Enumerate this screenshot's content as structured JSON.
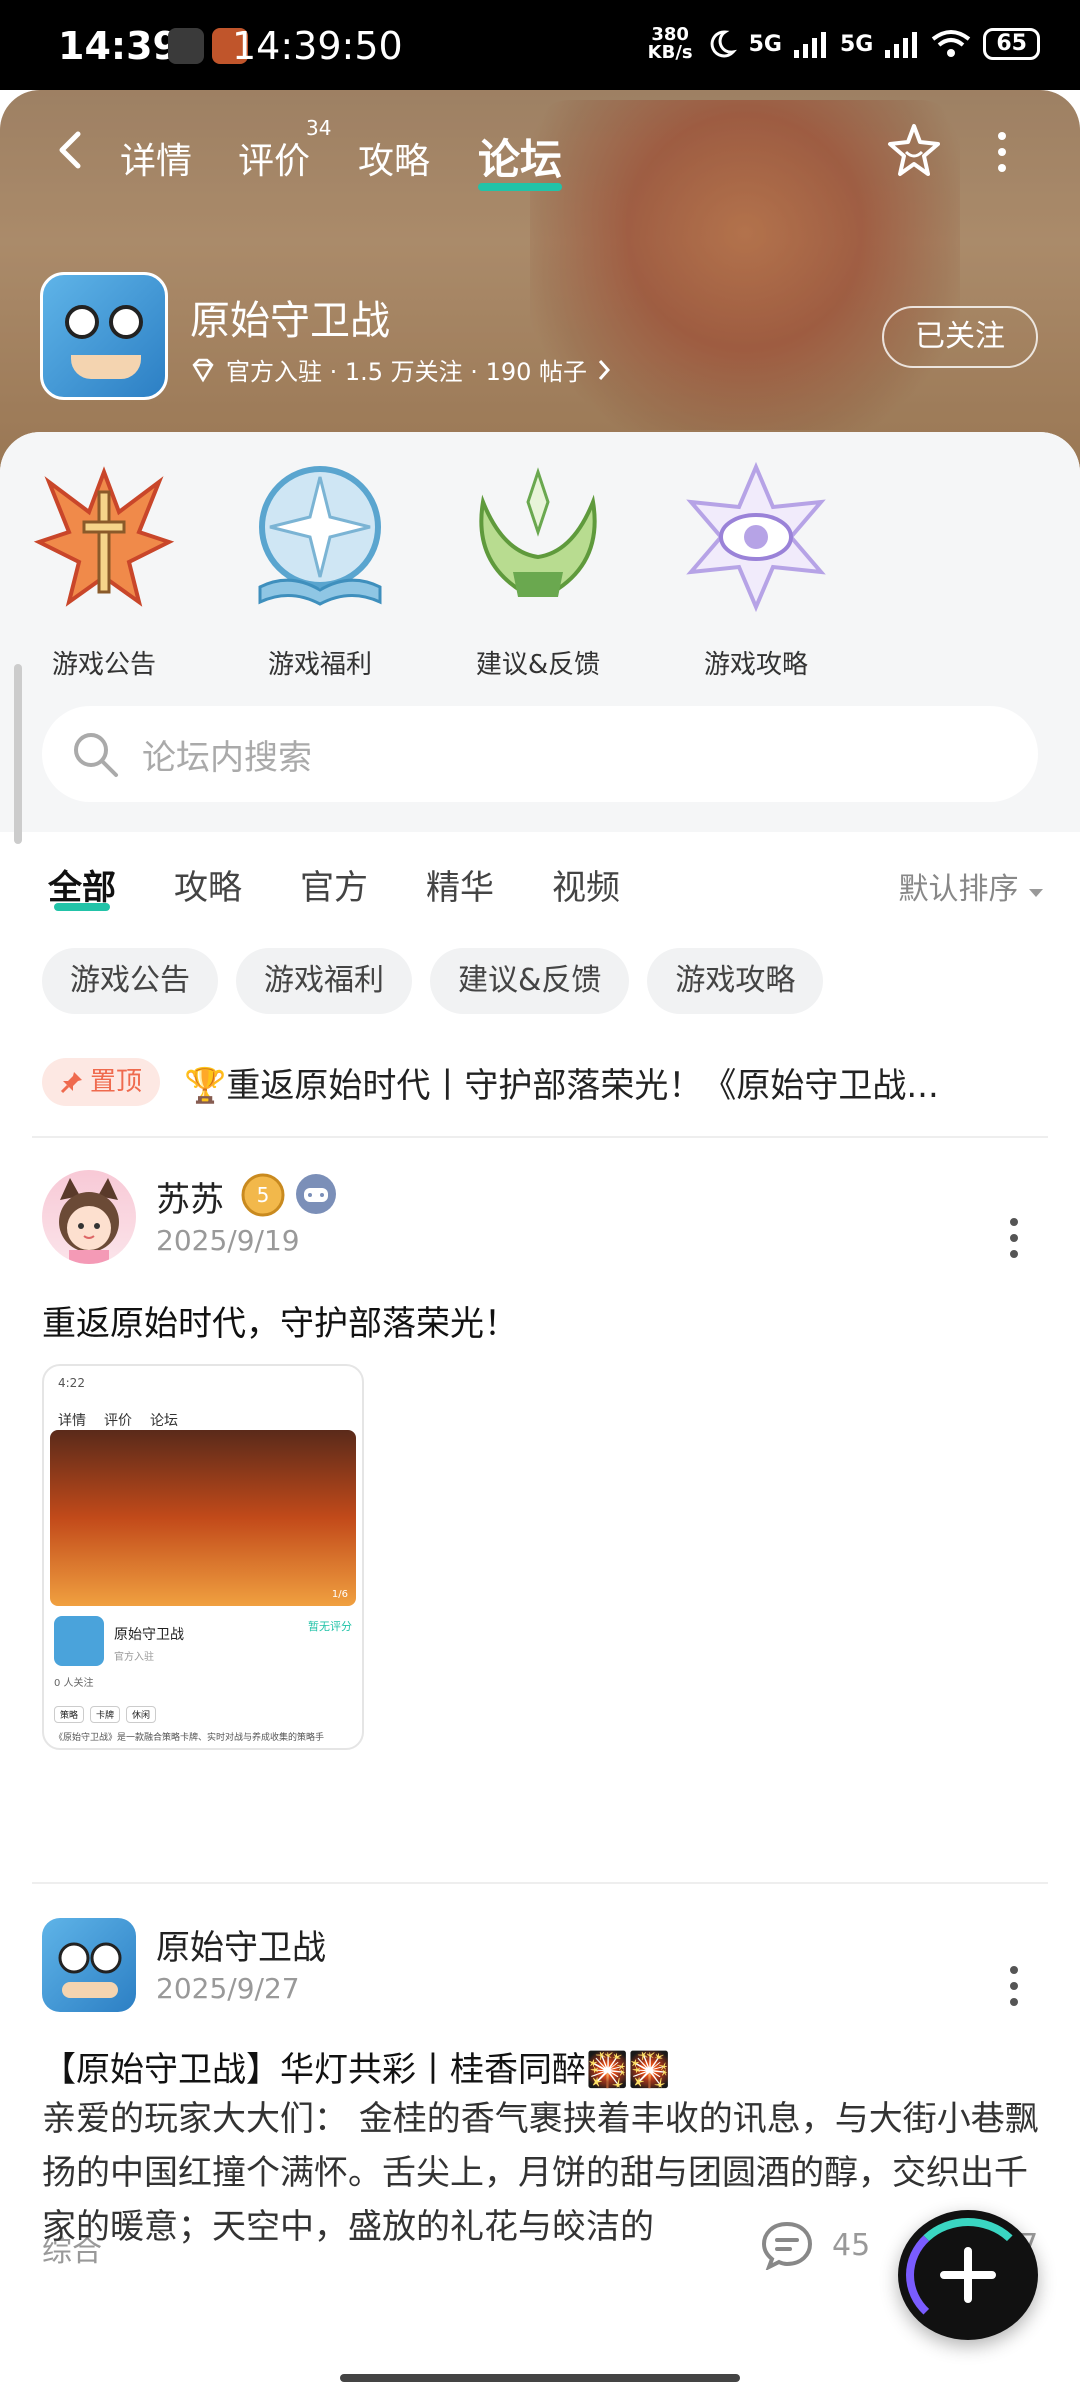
{
  "status_bar": {
    "time": "14:39",
    "clock": "14:39:50",
    "net_speed_top": "380",
    "net_speed_bottom": "KB/s",
    "signal1": "5G",
    "signal2": "5G",
    "battery": "65"
  },
  "nav": {
    "tabs": [
      {
        "label": "详情"
      },
      {
        "label": "评价"
      },
      {
        "label": "攻略"
      },
      {
        "label": "论坛"
      }
    ],
    "review_count": "34",
    "active_tab": "论坛"
  },
  "game": {
    "title": "原始守卫战",
    "meta": "官方入驻 · 1.5 万关注 · 190 帖子",
    "follow_label": "已关注"
  },
  "categories": [
    {
      "label": "游戏公告",
      "icon": "flame-sword-emblem-icon",
      "color": "#e8613a"
    },
    {
      "label": "游戏福利",
      "icon": "book-compass-emblem-icon",
      "color": "#7fb8d8"
    },
    {
      "label": "建议&反馈",
      "icon": "leaf-crown-emblem-icon",
      "color": "#8bc06a"
    },
    {
      "label": "游戏攻略",
      "icon": "eye-star-emblem-icon",
      "color": "#b6a3e6"
    }
  ],
  "search": {
    "placeholder": "论坛内搜索"
  },
  "filter_tabs": [
    {
      "label": "全部"
    },
    {
      "label": "攻略"
    },
    {
      "label": "官方"
    },
    {
      "label": "精华"
    },
    {
      "label": "视频"
    }
  ],
  "sort_label": "默认排序",
  "chips": [
    {
      "label": "游戏公告"
    },
    {
      "label": "游戏福利"
    },
    {
      "label": "建议&反馈"
    },
    {
      "label": "游戏攻略"
    }
  ],
  "pinned": {
    "badge": "置顶",
    "title": "🏆重返原始时代丨守护部落荣光！《原始守卫战..."
  },
  "posts": [
    {
      "author": "苏苏",
      "level": "5",
      "date": "2025/9/19",
      "title": "重返原始时代，守护部落荣光！",
      "thumb": {
        "time": "4:22",
        "tabs": [
          "详情",
          "评价",
          "论坛"
        ],
        "game": "原始守卫战",
        "rating": "暂无评分",
        "official": "官方入驻",
        "followers": "0 人关注",
        "tags": [
          "策略",
          "卡牌",
          "休闲"
        ],
        "desc": "《原始守卫战》是一款融合策略卡牌、实时对战与养成收集的策略手",
        "page": "1/6"
      },
      "tag": "综合",
      "comments": "45",
      "likes": "17"
    },
    {
      "author": "原始守卫战",
      "date": "2025/9/27",
      "title": "【原始守卫战】华灯共彩丨桂香同醉🎇🎇",
      "body": "亲爱的玩家大大们：  金桂的香气裹挟着丰收的讯息，与大街小巷飘扬的中国红撞个满怀。舌尖上，月饼的甜与团圆酒的醇，交织出千家的暖意；天空中，盛放的礼花与皎洁的"
    }
  ]
}
